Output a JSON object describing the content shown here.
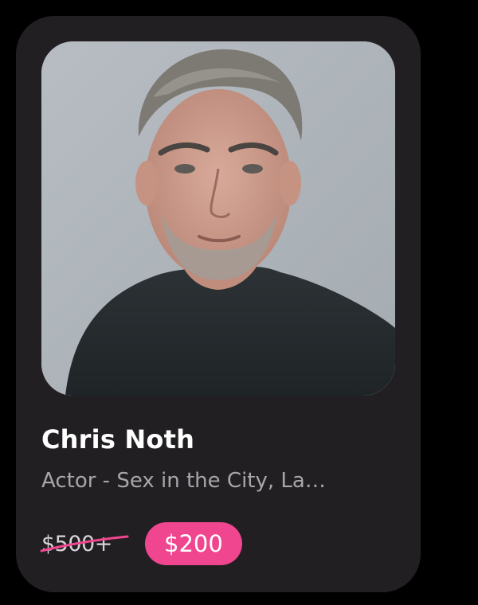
{
  "card": {
    "name": "Chris Noth",
    "subtitle": "Actor - Sex in the City, La…",
    "original_price": "$500+",
    "discount_price": "$200"
  },
  "colors": {
    "background": "#000000",
    "card_bg": "#221f23",
    "accent": "#f0468f",
    "subtitle_text": "#a8a6ab"
  }
}
